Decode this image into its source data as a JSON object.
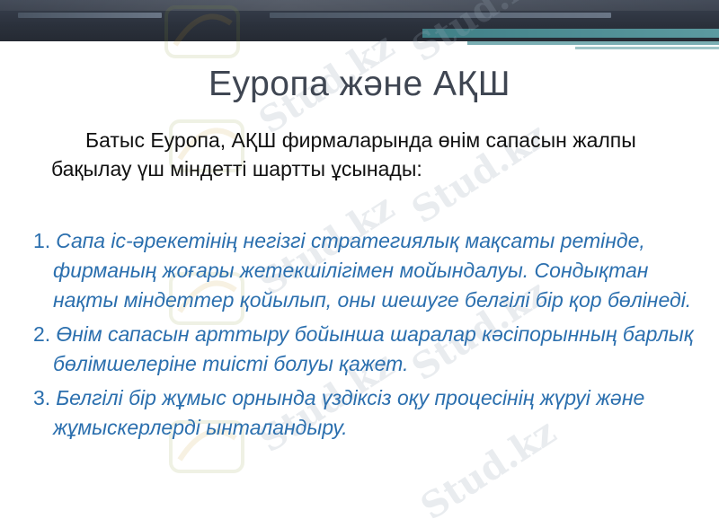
{
  "slide": {
    "title": "Еуропа және АҚШ",
    "intro": "Батыс Еуропа, АҚШ фирмаларында өнім сапасын жалпы бақылау үш міндетті шартты ұсынады:",
    "items": [
      {
        "number": "1.",
        "text": "Сапа іс-әрекетінің негізгі стратегиялық мақсаты ретінде, фирманың жоғары жетекшілігімен мойындалуы. Сондықтан нақты міндеттер қойылып, оны шешуге белгілі бір қор бөлінеді."
      },
      {
        "number": "2.",
        "text": "Өнім сапасын арттыру бойынша шаралар кәсіпорынның барлық бөлімшелеріне тиісті болуы қажет."
      },
      {
        "number": "3.",
        "text": "Белгілі бір жұмыс орнында үздіксіз оқу процесінің жүруі және жұмыскерлерді ынталандыру."
      }
    ]
  },
  "watermark": {
    "text": "Stud.kz"
  },
  "colors": {
    "title": "#3f4652",
    "intro_text": "#111111",
    "list_text": "#2b6fae",
    "header_dark": "#2b313c",
    "teal_accent": "#3f7f86"
  }
}
